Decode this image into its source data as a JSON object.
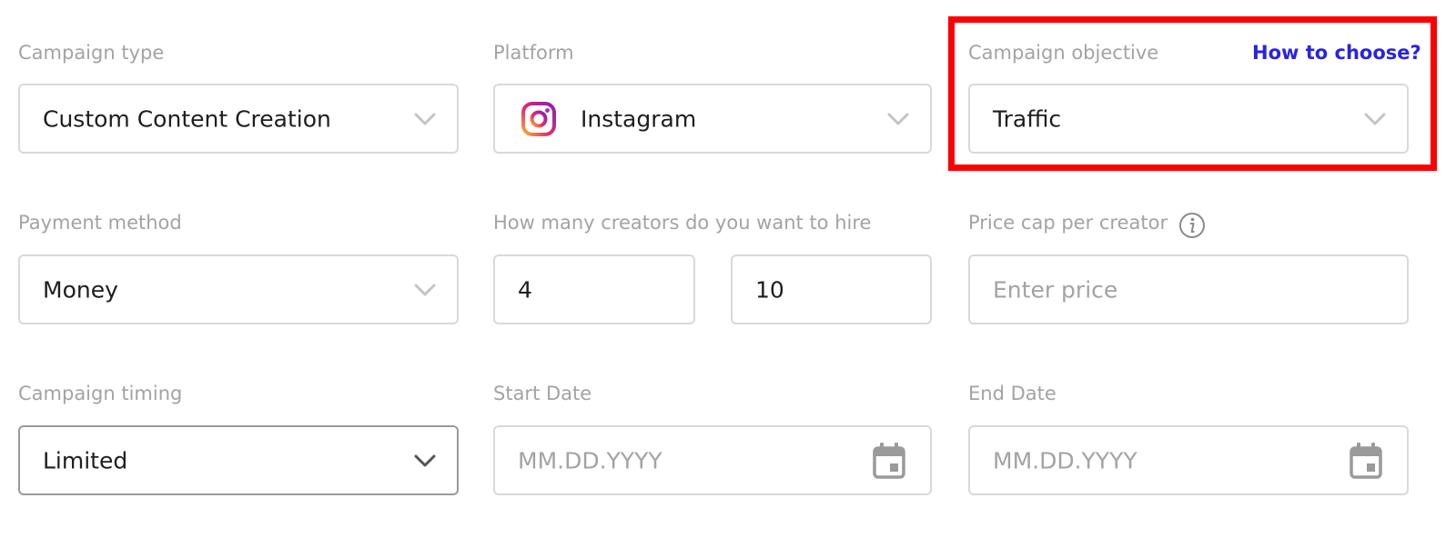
{
  "campaign_type": {
    "label": "Campaign type",
    "value": "Custom Content Creation"
  },
  "platform": {
    "label": "Platform",
    "value": "Instagram",
    "icon": "instagram-icon"
  },
  "campaign_objective": {
    "label": "Campaign objective",
    "value": "Traffic",
    "help_link": "How to choose?"
  },
  "payment_method": {
    "label": "Payment method",
    "value": "Money"
  },
  "creators": {
    "label": "How many creators do you want to hire",
    "min_value": "4",
    "max_value": "10"
  },
  "price_cap": {
    "label": "Price cap per creator",
    "placeholder": "Enter price",
    "info_icon": "info-icon"
  },
  "campaign_timing": {
    "label": "Campaign timing",
    "value": "Limited"
  },
  "start_date": {
    "label": "Start Date",
    "placeholder": "MM.DD.YYYY",
    "icon": "calendar-icon"
  },
  "end_date": {
    "label": "End Date",
    "placeholder": "MM.DD.YYYY",
    "icon": "calendar-icon"
  },
  "colors": {
    "highlight": "#ff0000",
    "link": "#2a23e0",
    "label": "#a3a3a3",
    "border": "#d9d9d9"
  }
}
